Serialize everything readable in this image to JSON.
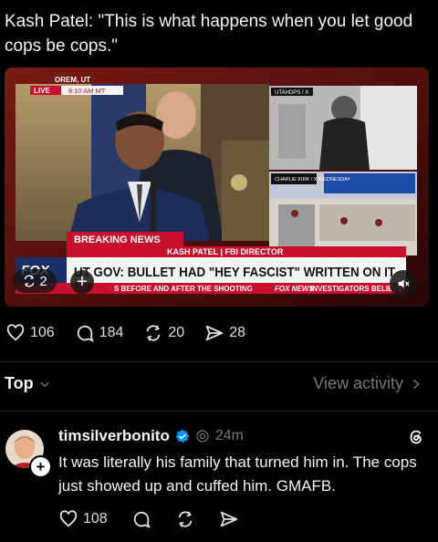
{
  "post": {
    "text": "Kash Patel: \"This is what happens when you let good cops be cops.\""
  },
  "media": {
    "location": "OREM, UT",
    "live_label": "LIVE",
    "live_time": "8:10 AM MT",
    "breaking_label": "BREAKING NEWS",
    "name_line": "KASH PATEL | FBI DIRECTOR",
    "headline": "UT GOV: BULLET HAD \"HEY FASCIST\" WRITTEN ON IT",
    "ticker": "S BEFORE AND AFTER THE SHOOTING",
    "ticker_brand": "FOX NEWS",
    "ticker_tail": "INVESTIGATORS BELIEVE",
    "inset1_tag": "UTAHDPS / X",
    "inset2_tag": "CHARLIE KIRK / X WEDNESDAY",
    "repost_count": "2"
  },
  "actions": {
    "likes": "106",
    "replies": "184",
    "reposts": "20",
    "shares": "28"
  },
  "sort": {
    "label": "Top",
    "view_activity": "View activity"
  },
  "reply": {
    "username": "timsilverbonito",
    "time": "24m",
    "text": "It was literally his family that turned him in. The cops just showed up and cuffed him. GMAFB.",
    "likes": "108"
  },
  "colors": {
    "background": "#000000",
    "text": "#f3f5f7",
    "muted": "#777777",
    "verified": "#0095f6",
    "fox_red": "#c8102e"
  },
  "icons": [
    "repost-icon",
    "plus-icon",
    "mute-icon",
    "heart-icon",
    "comment-icon",
    "repost-icon",
    "share-icon",
    "chevron-down-icon",
    "chevron-right-icon",
    "verified-badge-icon",
    "ai-label-icon",
    "threads-logo-icon"
  ]
}
